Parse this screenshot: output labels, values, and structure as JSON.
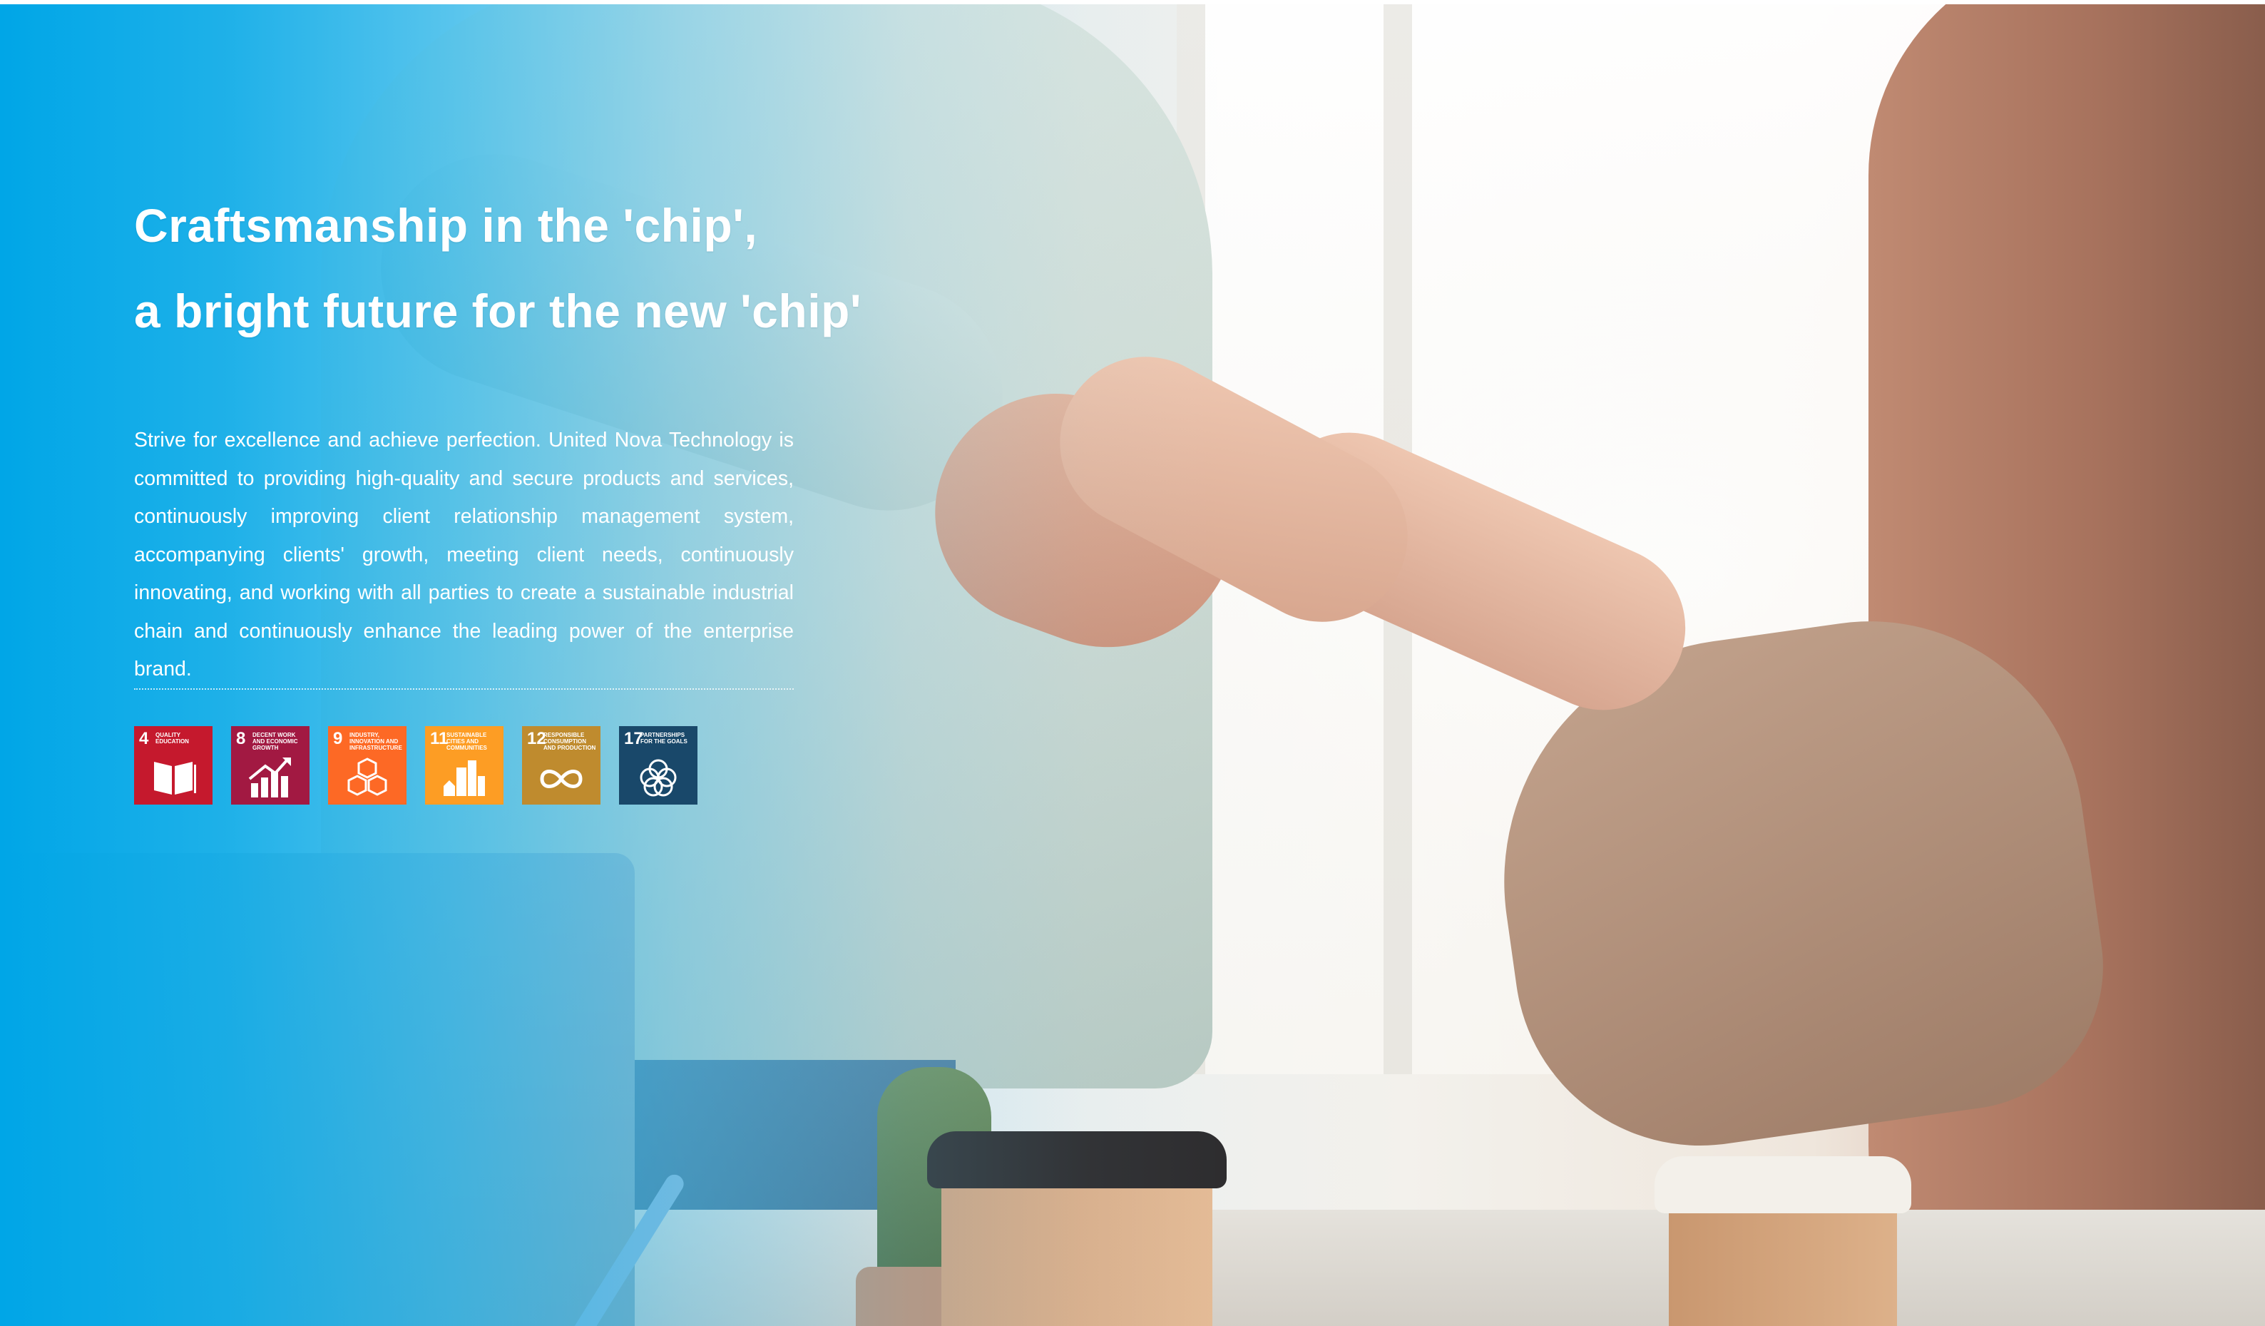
{
  "hero": {
    "headline_line1": "Craftsmanship in the 'chip',",
    "headline_line2": "a bright future for the new 'chip'",
    "description": "Strive for excellence and achieve perfection. United Nova Technology is committed to providing high-quality and secure products and services, continuously improving client relationship management system, accompanying clients' growth, meeting client needs, continuously innovating, and working with all parties to create a sustainable industrial chain and continuously enhance the leading power of the enterprise brand.",
    "overlay_color": "#00A6E7"
  },
  "sdg_badges": [
    {
      "number": "4",
      "label": "Quality Education",
      "color": "#C5192D",
      "icon": "book-icon"
    },
    {
      "number": "8",
      "label": "Decent Work and Economic Growth",
      "color": "#A21942",
      "icon": "growth-chart-icon"
    },
    {
      "number": "9",
      "label": "Industry, Innovation and Infrastructure",
      "color": "#FD6925",
      "icon": "cubes-icon"
    },
    {
      "number": "11",
      "label": "Sustainable Cities and Communities",
      "color": "#FD9D24",
      "icon": "buildings-icon"
    },
    {
      "number": "12",
      "label": "Responsible Consumption and Production",
      "color": "#BF8B2E",
      "icon": "infinity-icon"
    },
    {
      "number": "17",
      "label": "Partnerships for the Goals",
      "color": "#19486A",
      "icon": "rings-icon"
    }
  ]
}
